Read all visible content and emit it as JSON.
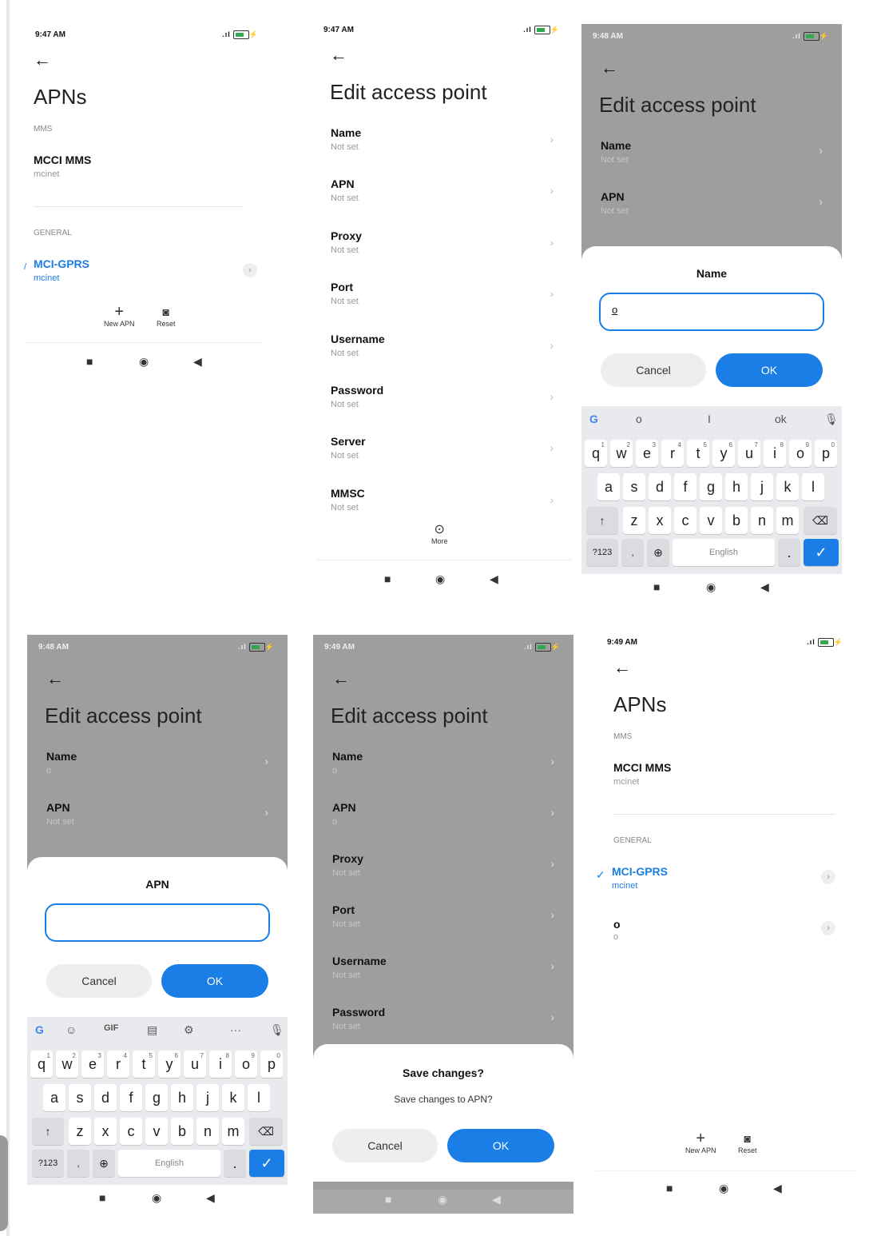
{
  "screens": {
    "apns1": {
      "time": "9:47 AM",
      "title": "APNs",
      "mms_label": "MMS",
      "mms_item": {
        "name": "MCCI MMS",
        "sub": "mcinet"
      },
      "general_label": "GENERAL",
      "general_item": {
        "name": "MCI-GPRS",
        "sub": "mcinet"
      },
      "new_apn": "New APN",
      "reset": "Reset"
    },
    "edit1": {
      "time": "9:47 AM",
      "title": "Edit access point",
      "fields": [
        {
          "name": "Name",
          "value": "Not set"
        },
        {
          "name": "APN",
          "value": "Not set"
        },
        {
          "name": "Proxy",
          "value": "Not set"
        },
        {
          "name": "Port",
          "value": "Not set"
        },
        {
          "name": "Username",
          "value": "Not set"
        },
        {
          "name": "Password",
          "value": "Not set"
        },
        {
          "name": "Server",
          "value": "Not set"
        },
        {
          "name": "MMSC",
          "value": "Not set"
        }
      ],
      "more": "More"
    },
    "name_dialog": {
      "time": "9:48 AM",
      "title": "Edit access point",
      "fields": [
        {
          "name": "Name",
          "value": "Not set"
        },
        {
          "name": "APN",
          "value": "Not set"
        }
      ],
      "dialog_title": "Name",
      "input_value": "o",
      "cancel": "Cancel",
      "ok": "OK",
      "suggestions": [
        "o",
        "I",
        "ok"
      ],
      "keyboard_label": "English",
      "sym_key": "?123"
    },
    "apn_dialog": {
      "time": "9:48 AM",
      "title": "Edit access point",
      "fields": [
        {
          "name": "Name",
          "value": "o"
        },
        {
          "name": "APN",
          "value": "Not set"
        }
      ],
      "dialog_title": "APN",
      "input_value": "",
      "cancel": "Cancel",
      "ok": "OK",
      "toolbar": [
        "GIF"
      ],
      "keyboard_label": "English",
      "sym_key": "?123"
    },
    "save_dialog": {
      "time": "9:49 AM",
      "title": "Edit access point",
      "fields": [
        {
          "name": "Name",
          "value": "o"
        },
        {
          "name": "APN",
          "value": "o"
        },
        {
          "name": "Proxy",
          "value": "Not set"
        },
        {
          "name": "Port",
          "value": "Not set"
        },
        {
          "name": "Username",
          "value": "Not set"
        },
        {
          "name": "Password",
          "value": "Not set"
        }
      ],
      "dialog_title": "Save changes?",
      "dialog_msg": "Save changes to APN?",
      "cancel": "Cancel",
      "ok": "OK"
    },
    "apns2": {
      "time": "9:49 AM",
      "title": "APNs",
      "mms_label": "MMS",
      "mms_item": {
        "name": "MCCI MMS",
        "sub": "mcinet"
      },
      "general_label": "GENERAL",
      "general_item": {
        "name": "MCI-GPRS",
        "sub": "mcinet"
      },
      "new_item": {
        "name": "o",
        "sub": "o"
      },
      "new_apn": "New APN",
      "reset": "Reset"
    }
  },
  "keyboard": {
    "row1": [
      "q",
      "w",
      "e",
      "r",
      "t",
      "y",
      "u",
      "i",
      "o",
      "p"
    ],
    "row1_digits": [
      "1",
      "2",
      "3",
      "4",
      "5",
      "6",
      "7",
      "8",
      "9",
      "0"
    ],
    "row2": [
      "a",
      "s",
      "d",
      "f",
      "g",
      "h",
      "j",
      "k",
      "l"
    ],
    "row3": [
      "z",
      "x",
      "c",
      "v",
      "b",
      "n",
      "m"
    ]
  },
  "colors": {
    "accent": "#1a7ee6",
    "dim": "#9e9e9e"
  }
}
